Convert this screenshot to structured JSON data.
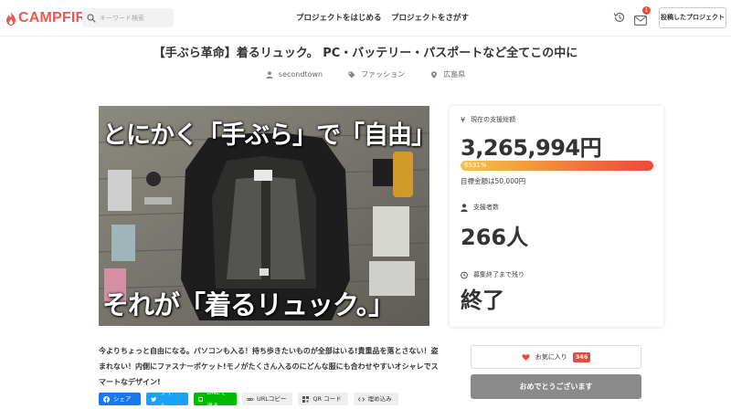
{
  "header": {
    "logo_text": "CAMPFIRE",
    "search_placeholder": "キーワード検索",
    "nav_start": "プロジェクトをはじめる",
    "nav_find": "プロジェクトをさがす",
    "mail_badge": "1",
    "posted_projects": "投稿したプロジェクト",
    "icons": [
      "flame-logo-icon",
      "search-icon",
      "history-icon",
      "mail-icon"
    ]
  },
  "project": {
    "title": "【手ぶら革命】着るリュック。 PC・バッテリー・パスポートなど全てこの中に",
    "owner": "secondtown",
    "category": "ファッション",
    "location": "広島県",
    "hero_text_top": "とにかく「手ぶら」で「自由」に。",
    "hero_text_bottom": "それが「着るリュック。」",
    "description": "今よりちょっと自由になる。パソコンも入る！持ち歩きたいものが全部はいる!貴重品を落とさない！盗まれない！内側にファスナーポケット!モノがたくさん入るのにどんな服にも合わせやすいオシャレでスマートなデザイン!"
  },
  "stats": {
    "raised_label": "現在の支援総額",
    "raised_amount": "3,265,994円",
    "progress_percent": 6531,
    "progress_text": "6531%",
    "goal_text": "目標金額は50,000円",
    "backers_label": "支援者数",
    "backers_count": "266人",
    "remaining_label": "募集終了まで残り",
    "remaining_value": "終了",
    "colors": {
      "accent": "#e85a4f",
      "progress_start": "#f5c34b",
      "progress_end": "#eb4b3b"
    }
  },
  "share": {
    "facebook": "シェア",
    "twitter": "ツイート",
    "line": "LINEで送る",
    "url_copy": "URLコピー",
    "qr_code": "QR コード",
    "embed": "埋め込み"
  },
  "actions": {
    "favorite_label": "お気に入り",
    "favorite_count": "346",
    "ended_label": "おめでとうございます"
  }
}
